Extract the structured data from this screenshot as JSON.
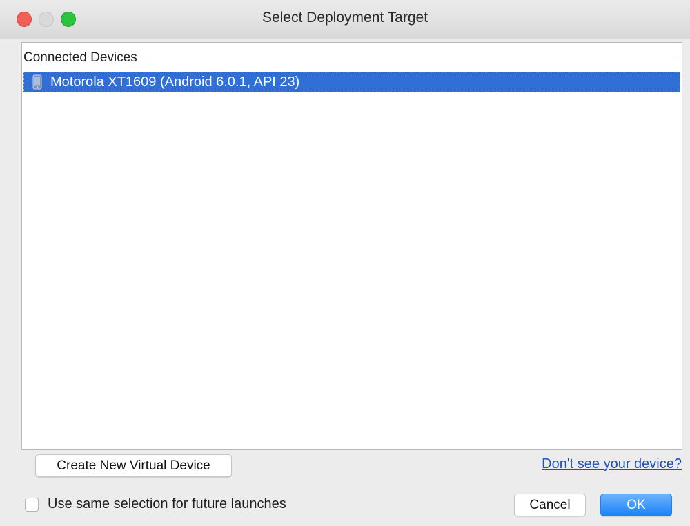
{
  "window": {
    "title": "Select Deployment Target"
  },
  "devices": {
    "section_label": "Connected Devices",
    "items": [
      {
        "label": "Motorola XT1609 (Android 6.0.1, API 23)",
        "icon": "phone-icon",
        "selected": true
      }
    ]
  },
  "actions": {
    "create_label": "Create New Virtual Device",
    "help_link": "Don't see your device?",
    "checkbox_label": "Use same selection for future launches",
    "checkbox_checked": false,
    "cancel_label": "Cancel",
    "ok_label": "OK"
  },
  "colors": {
    "selection": "#2f6fd6",
    "link": "#1f4ec4",
    "ok_button": "#1a82fb"
  }
}
